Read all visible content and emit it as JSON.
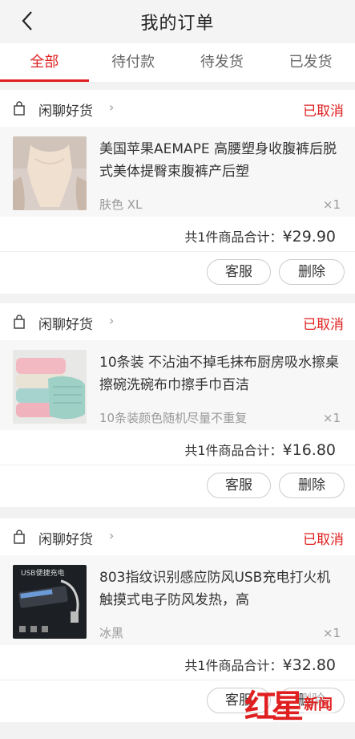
{
  "header": {
    "title": "我的订单"
  },
  "tabs": [
    {
      "label": "全部"
    },
    {
      "label": "待付款"
    },
    {
      "label": "待发货"
    },
    {
      "label": "已发货"
    }
  ],
  "orders": [
    {
      "shop": "闲聊好货",
      "status": "已取消",
      "name": "美国苹果AEMAPE 高腰塑身收腹裤后脱式美体提臀束腹裤产后塑",
      "spec": "肤色  XL",
      "qty": "×1",
      "total_label": "共1件商品合计：",
      "price": "¥29.90",
      "service_label": "客服",
      "delete_label": "删除"
    },
    {
      "shop": "闲聊好货",
      "status": "已取消",
      "name": "10条装 不沾油不掉毛抹布厨房吸水擦桌擦碗洗碗布巾擦手巾百洁",
      "spec": "10条装颜色随机尽量不重复",
      "qty": "×1",
      "total_label": "共1件商品合计：",
      "price": "¥16.80",
      "service_label": "客服",
      "delete_label": "删除"
    },
    {
      "shop": "闲聊好货",
      "status": "已取消",
      "name": "803指纹识别感应防风USB充电打火机触摸式电子防风发热，高",
      "spec": "冰黑",
      "qty": "×1",
      "total_label": "共1件商品合计：",
      "price": "¥32.80",
      "service_label": "客服",
      "delete_label": "删除",
      "thumb_text": "USB便捷充电"
    }
  ],
  "watermark": {
    "logo": "红星",
    "text": "新闻"
  }
}
